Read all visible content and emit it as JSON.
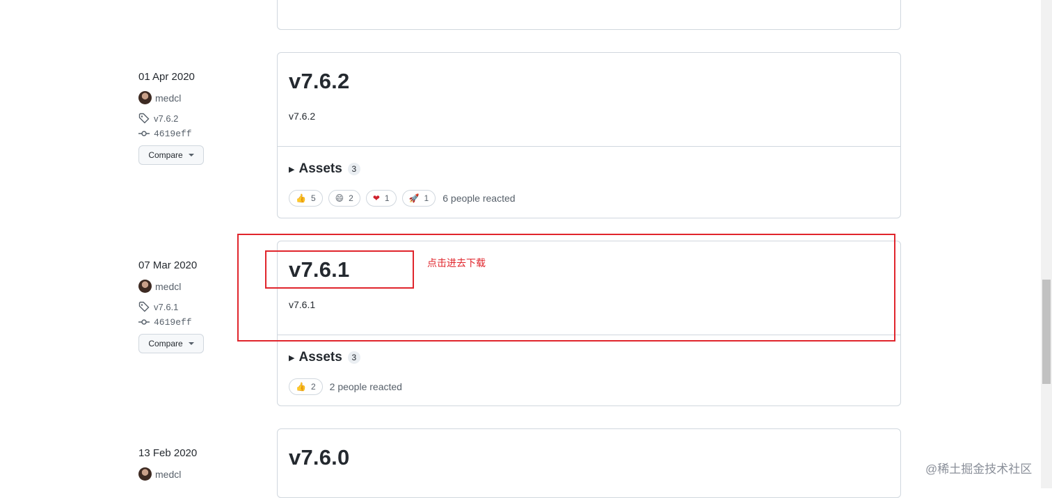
{
  "top_card": {},
  "releases": [
    {
      "date": "01 Apr 2020",
      "author": "medcl",
      "tag": "v7.6.2",
      "commit": "4619eff",
      "compare_label": "Compare",
      "title": "v7.6.2",
      "body": "v7.6.2",
      "assets_label": "Assets",
      "assets_count": "3",
      "reactions": [
        {
          "icon": "thumbs-up-icon",
          "emoji": "👍",
          "count": "5"
        },
        {
          "icon": "laugh-icon",
          "emoji": "😄",
          "count": "2"
        },
        {
          "icon": "heart-icon",
          "emoji": "❤",
          "count": "1"
        },
        {
          "icon": "rocket-icon",
          "emoji": "🚀",
          "count": "1"
        }
      ],
      "reacted_text": "6 people reacted"
    },
    {
      "date": "07 Mar 2020",
      "author": "medcl",
      "tag": "v7.6.1",
      "commit": "4619eff",
      "compare_label": "Compare",
      "title": "v7.6.1",
      "body": "v7.6.1",
      "assets_label": "Assets",
      "assets_count": "3",
      "reactions": [
        {
          "icon": "thumbs-up-icon",
          "emoji": "👍",
          "count": "2"
        }
      ],
      "reacted_text": "2 people reacted"
    },
    {
      "date": "13 Feb 2020",
      "author": "medcl",
      "title": "v7.6.0"
    }
  ],
  "annotation": "点击进去下载",
  "watermark": "@稀土掘金技术社区",
  "colors": {
    "annotation_red": "#e0242b",
    "border": "#d0d7de",
    "text": "#24292f",
    "muted": "#57606a"
  }
}
